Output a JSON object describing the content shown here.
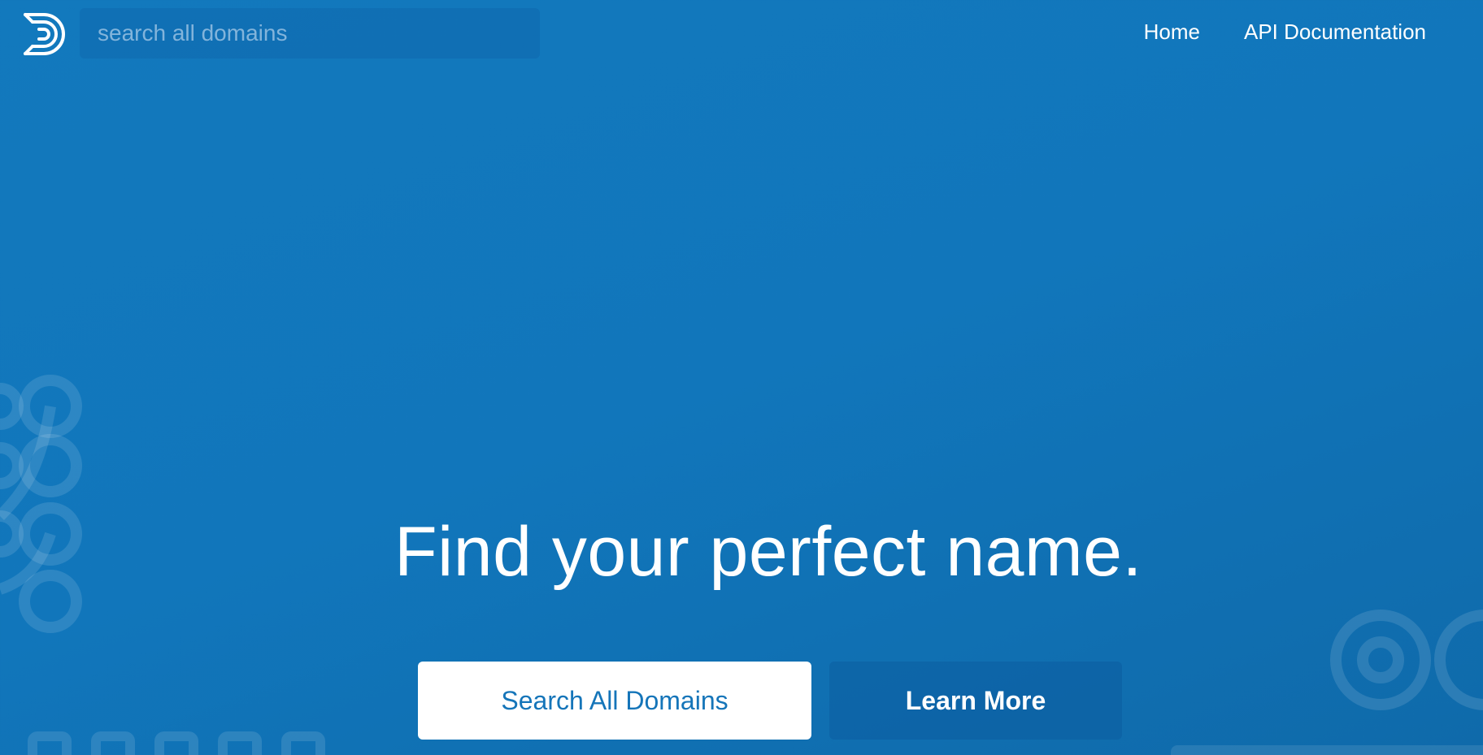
{
  "header": {
    "logo_icon": "domainr-d-logo-icon",
    "search": {
      "placeholder": "search all domains",
      "value": ""
    },
    "nav": {
      "home_label": "Home",
      "api_docs_label": "API Documentation"
    }
  },
  "hero": {
    "title": "Find your perfect name.",
    "primary_button_label": "Search All Domains",
    "secondary_button_label": "Learn More"
  },
  "colors": {
    "background": "#1279bd",
    "primary_button_text": "#1575b9",
    "primary_button_bg": "#ffffff"
  }
}
